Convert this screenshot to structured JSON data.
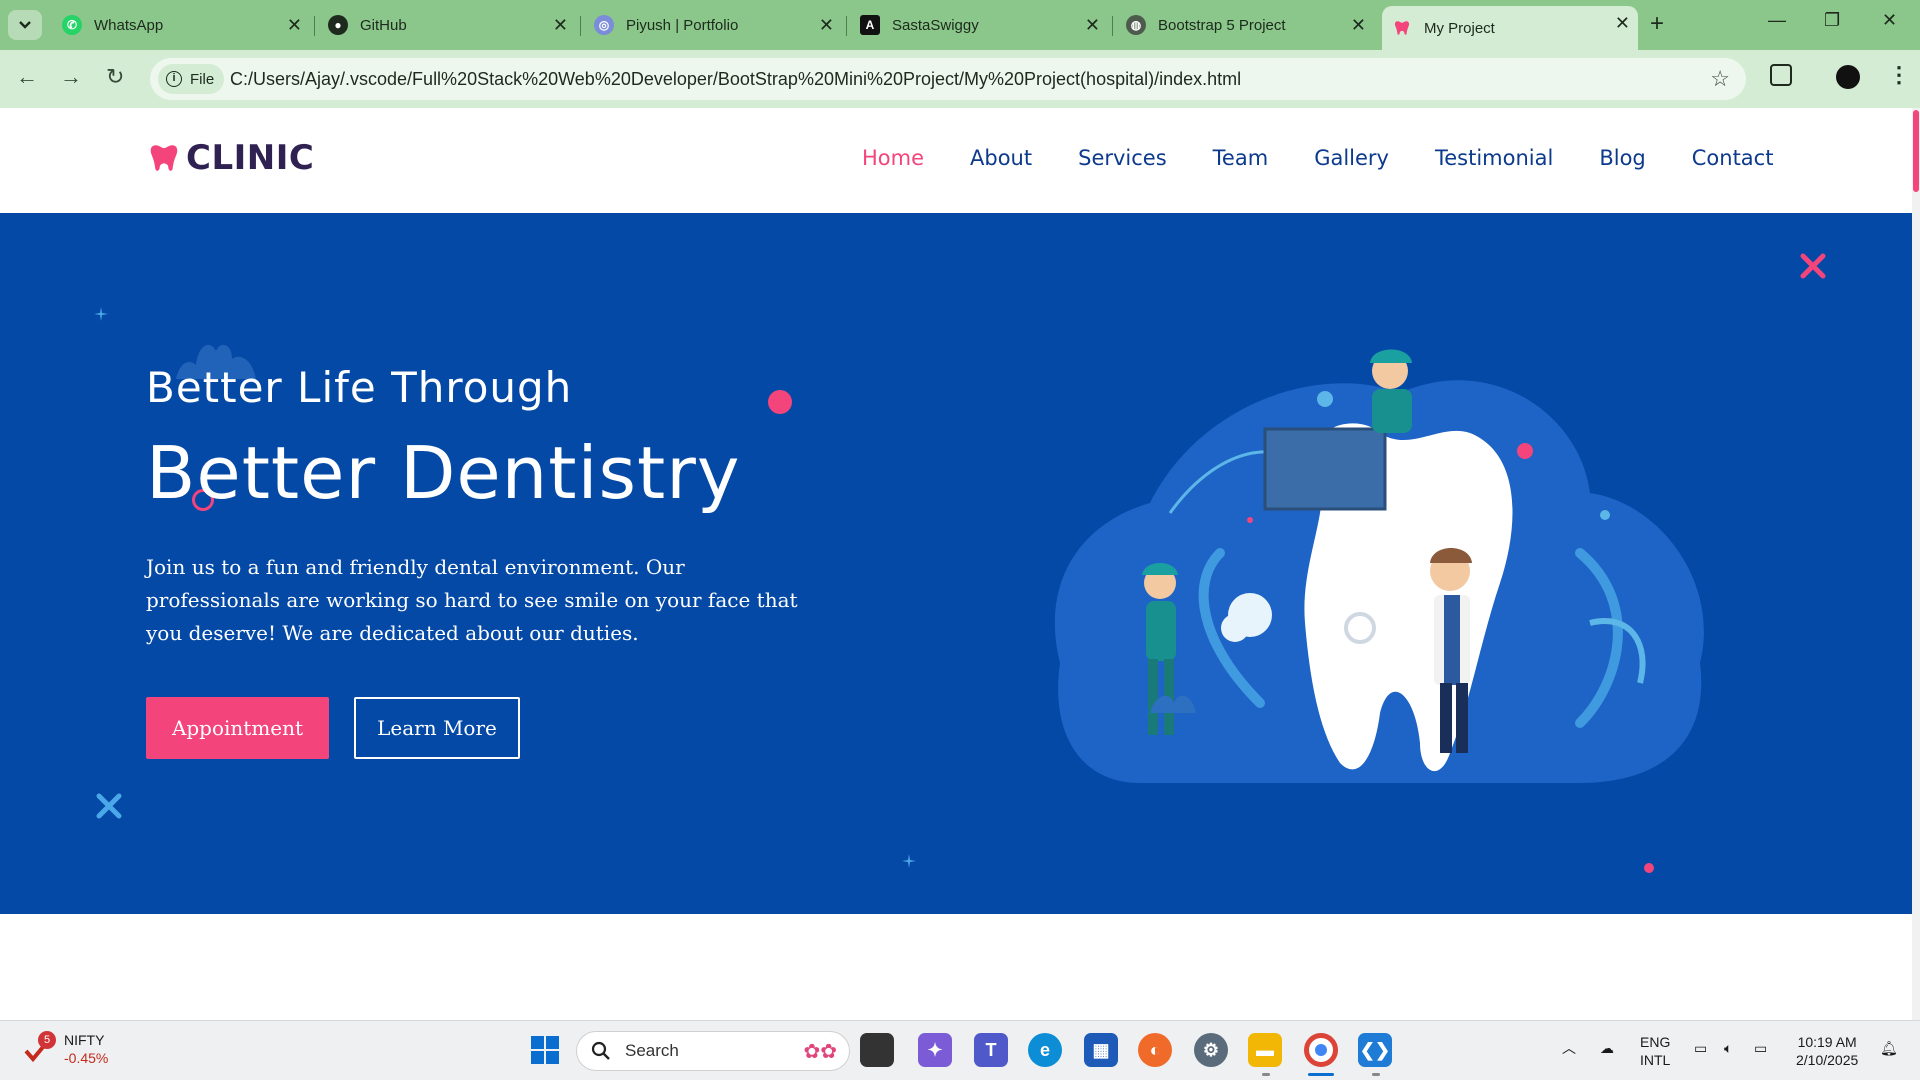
{
  "browser": {
    "tabs": [
      {
        "label": "WhatsApp",
        "icon": "whatsapp-icon"
      },
      {
        "label": "GitHub",
        "icon": "github-icon"
      },
      {
        "label": "Piyush | Portfolio",
        "icon": "portfolio-icon"
      },
      {
        "label": "SastaSwiggy",
        "icon": "angular-icon"
      },
      {
        "label": "Bootstrap 5 Project",
        "icon": "globe-icon"
      },
      {
        "label": "My Project",
        "icon": "tooth-icon",
        "active": true
      }
    ],
    "file_chip": "File",
    "url": "C:/Users/Ajay/.vscode/Full%20Stack%20Web%20Developer/BootStrap%20Mini%20Project/My%20Project(hospital)/index.html"
  },
  "site": {
    "logo_text": "CLINIC",
    "nav": [
      "Home",
      "About",
      "Services",
      "Team",
      "Gallery",
      "Testimonial",
      "Blog",
      "Contact"
    ],
    "active_nav": "Home",
    "hero": {
      "subtitle": "Better Life Through",
      "title": "Better Dentistry",
      "description": "Join us to a fun and friendly dental environment. Our professionals are working so hard to see smile on your face that you deserve! We are dedicated about our duties.",
      "primary_button": "Appointment",
      "secondary_button": "Learn More"
    },
    "colors": {
      "primary": "#0449a6",
      "accent": "#f3457c",
      "heading": "#2f2253",
      "nav": "#0c3a8c"
    }
  },
  "taskbar": {
    "widget": {
      "name": "NIFTY",
      "change": "-0.45%",
      "badge": "5"
    },
    "search_label": "Search",
    "language": "ENG",
    "layout": "INTL",
    "time": "10:19 AM",
    "date": "2/10/2025"
  }
}
